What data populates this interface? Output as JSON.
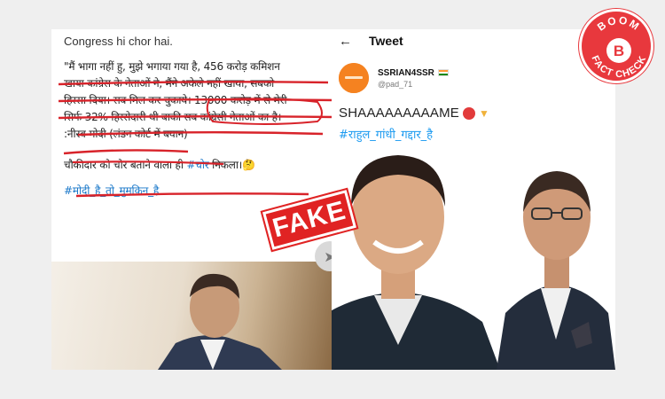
{
  "left_post": {
    "line_english": "Congress hi chor hai.",
    "quote_lines": [
      "\"मैं भागा नहीं हु, मुझे भगाया गया है, 456 करोड़ कमिशन",
      "खाया कांग्रेस के नेताओं ने, मैंने अकेले नहीं खाया, सबको",
      "हिस्सा दिया। सब मिल कर चुकाये। 13000 करोड़ में से मेरी",
      "सिर्फ 32% हिस्सेदारी थी बाकी सब कांग्रेसी नेताओं का है।",
      ":नीरव मोदी (लंडन कोर्ट में बयान)"
    ],
    "line_chowkidar_prefix": "चौकीदार को चोर बताने वाला ही ",
    "line_chowkidar_hashtag": "#चोर",
    "line_chowkidar_suffix": " निकला।🤔",
    "hashtag": "#मोदी_है_तो_मुमकिन_है"
  },
  "right_tweet": {
    "header_title": "Tweet",
    "back_icon": "arrow-left-icon",
    "author_name": "SSRIAN4SSR",
    "author_handle": "@pad_71",
    "text": "SHAAAAAAAAAME",
    "hashtag": "#राहुल_गांधी_गद्दार_है"
  },
  "stamp": {
    "label": "FAKE",
    "color": "#e02323"
  },
  "badge": {
    "top_text": "BOOM",
    "letter": "B",
    "bottom_text": "FACT CHECK",
    "color": "#e8383d"
  }
}
